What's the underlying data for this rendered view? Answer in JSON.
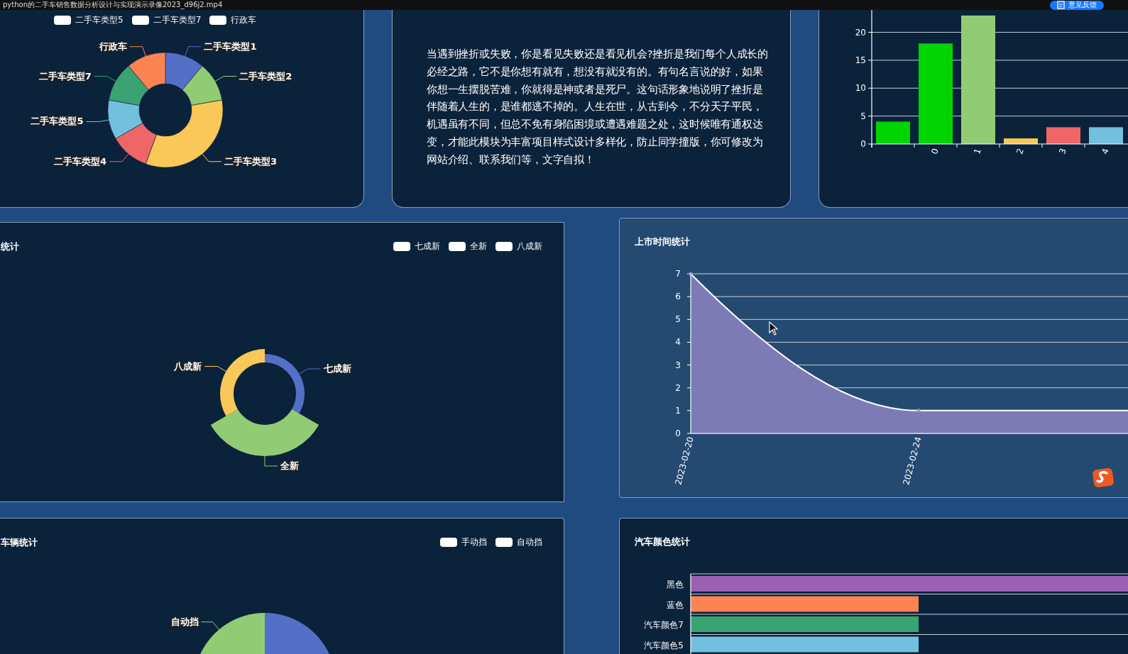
{
  "video_title": "python的二手车销售数据分析设计与实现演示录像2023_d96j2.mp4",
  "feedback_button": {
    "label": "意见反馈"
  },
  "type_panel": {
    "legend": [
      {
        "label": "二手车类型5",
        "selected": true
      },
      {
        "label": "二手车类型7",
        "selected": true
      },
      {
        "label": "行政车",
        "selected": true
      }
    ],
    "chart_data": {
      "type": "donut",
      "categories": [
        "二手车类型1",
        "二手车类型2",
        "二手车类型3",
        "二手车类型4",
        "二手车类型5",
        "二手车类型7",
        "行政车"
      ],
      "colors": [
        "#5470c6",
        "#91cc75",
        "#fac858",
        "#ee6666",
        "#73c0de",
        "#3ba272",
        "#fc8452"
      ],
      "values": [
        1,
        1,
        3,
        1,
        1,
        1,
        1
      ]
    }
  },
  "intro_panel": {
    "text": "当遇到挫折或失败，你是看见失败还是看见机会?挫折是我们每个人成长的必经之路，它不是你想有就有，想没有就没有的。有句名言说的好，如果你想一生摆脱苦难，你就得是神或者是死尸。这句话形象地说明了挫折是伴随着人生的，是谁都逃不掉的。人生在世，从古到今，不分天子平民，机遇虽有不同，但总不免有身陷困境或遭遇难题之处，这时候唯有通权达变，才能此模块为丰富项目样式设计多样化，防止同学撞版，你可修改为网站介绍、联系我们等，文字自拟！"
  },
  "count_panel": {
    "chart_data": {
      "type": "bar",
      "categories": [
        null,
        "0",
        "1",
        "2",
        "3",
        "4"
      ],
      "colors": [
        "#00d400",
        "#00d400",
        "#91cc75",
        "#fac858",
        "#ee6666",
        "#73c0de"
      ],
      "values": [
        4,
        18,
        23,
        1,
        3,
        3
      ],
      "ylim": [
        0,
        24
      ],
      "yticks": [
        0,
        5,
        10,
        15,
        20
      ],
      "grid": true
    }
  },
  "condition_panel": {
    "title": "统计",
    "legend": [
      {
        "label": "七成新",
        "selected": true
      },
      {
        "label": "全新",
        "selected": true
      },
      {
        "label": "八成新",
        "selected": true
      }
    ],
    "rose": {
      "slices": [
        {
          "label": "七成新",
          "color": "#5470c6"
        },
        {
          "label": "全新",
          "color": "#91cc75"
        },
        {
          "label": "八成新",
          "color": "#fac858"
        }
      ]
    }
  },
  "listing_panel": {
    "title": "上市时间统计",
    "chart_data": {
      "type": "area",
      "x": [
        "2023-02-20",
        "2023-02-24",
        null
      ],
      "values": [
        7,
        1,
        1
      ],
      "ylim": [
        0,
        7
      ],
      "yticks": [
        0,
        1,
        2,
        3,
        4,
        5,
        6,
        7
      ],
      "color": "#7d7bb6",
      "grid": true
    }
  },
  "gearbox_panel": {
    "title": "车辆统计",
    "legend": [
      {
        "label": "手动挡",
        "selected": true
      },
      {
        "label": "自动挡",
        "selected": true
      }
    ],
    "pie": {
      "slices": [
        {
          "color": "#5470c6"
        },
        {
          "label": "自动挡",
          "color": "#91cc75"
        }
      ]
    }
  },
  "color_panel": {
    "title": "汽车颜色统计",
    "bars": [
      {
        "label": "黑色",
        "color": "#9a60b4"
      },
      {
        "label": "蓝色",
        "color": "#fc8452"
      },
      {
        "label": "汽车颜色7",
        "color": "#3ba272"
      },
      {
        "label": "汽车颜色5",
        "color": "#73c0de"
      }
    ]
  }
}
